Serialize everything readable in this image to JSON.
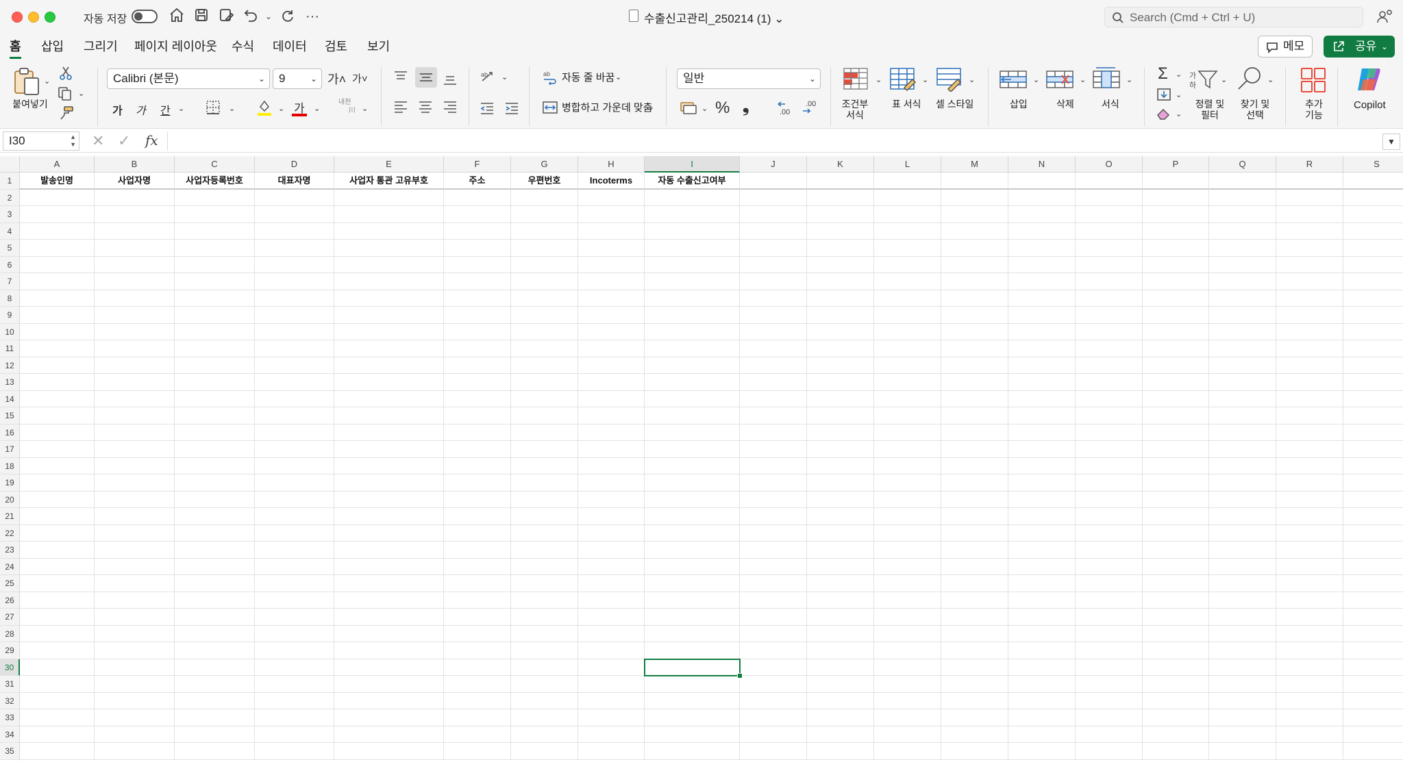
{
  "titlebar": {
    "autosave_label": "자동 저장",
    "document_title": "수출신고관리_250214 (1)",
    "search_placeholder": "Search (Cmd + Ctrl + U)"
  },
  "tabs": [
    "홈",
    "삽입",
    "그리기",
    "페이지 레이아웃",
    "수식",
    "데이터",
    "검토",
    "보기"
  ],
  "active_tab": "홈",
  "tab_buttons": {
    "memo": "메모",
    "share": "공유"
  },
  "ribbon": {
    "paste": "붙여넣기",
    "font_name": "Calibri (본문)",
    "font_size": "9",
    "grow_font": "가",
    "shrink_font": "가",
    "bold": "가",
    "italic": "가",
    "underline": "간",
    "font_color_glyph": "가",
    "phonetic": "내천",
    "wrap_text": "자동 줄 바꿈",
    "merge_center": "병합하고 가운데 맞춤",
    "number_format": "일반",
    "percent": "%",
    "comma": "❟",
    "conditional_format": [
      "조건부",
      "서식"
    ],
    "format_table": "표 서식",
    "cell_styles": "셀 스타일",
    "insert": "삽입",
    "delete": "삭제",
    "format": "서식",
    "sort_filter": [
      "정렬 및",
      "필터"
    ],
    "find_select": [
      "찾기 및",
      "선택"
    ],
    "addins": [
      "추가",
      "기능"
    ],
    "copilot": "Copilot"
  },
  "formula_bar": {
    "name_box": "I30",
    "formula": ""
  },
  "sheet": {
    "columns": [
      "A",
      "B",
      "C",
      "D",
      "E",
      "F",
      "G",
      "H",
      "I",
      "J",
      "K",
      "L",
      "M",
      "N",
      "O",
      "P",
      "Q",
      "R",
      "S"
    ],
    "selected_column": "I",
    "selected_row": 30,
    "row_numbers": [
      "1",
      "2",
      "3",
      "4",
      "5",
      "6",
      "7",
      "8",
      "9",
      "10",
      "11",
      "12",
      "13",
      "14",
      "15",
      "16",
      "17",
      "18",
      "19",
      "20",
      "21",
      "22",
      "23",
      "24",
      "25",
      "26",
      "27",
      "28",
      "29",
      "30",
      "31",
      "32",
      "33",
      "34",
      "35"
    ],
    "header_row": [
      "발송인명",
      "사업자명",
      "사업자등록번호",
      "대표자명",
      "사업자 통관 고유부호",
      "주소",
      "우편번호",
      "Incoterms",
      "자동 수출신고여부",
      "",
      "",
      "",
      "",
      "",
      "",
      "",
      "",
      "",
      ""
    ]
  }
}
